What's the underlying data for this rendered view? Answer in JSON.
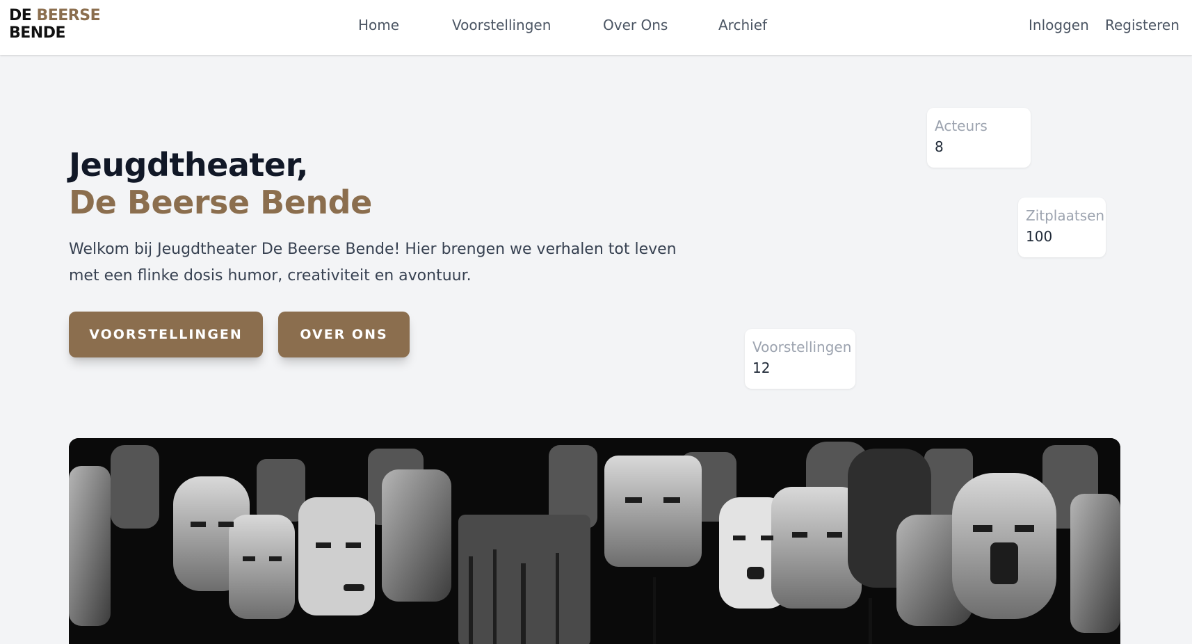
{
  "brand": {
    "line1_dark": "DE",
    "line1_accent": "BEERSE",
    "line2": "BENDE"
  },
  "nav": {
    "items": [
      {
        "label": "Home"
      },
      {
        "label": "Voorstellingen"
      },
      {
        "label": "Over Ons"
      },
      {
        "label": "Archief"
      }
    ],
    "login": "Inloggen",
    "register": "Registeren"
  },
  "hero": {
    "title_line1": "Jeugdtheater,",
    "title_line2": "De Beerse Bende",
    "intro": "Welkom bij Jeugdtheater De Beerse Bende! Hier brengen we verhalen tot leven met een flinke dosis humor, creativiteit en avontuur.",
    "primary_button": "VOORSTELLINGEN",
    "secondary_button": "OVER ONS",
    "image_icon": "theatre-masks-photo"
  },
  "stats": [
    {
      "label": "Acteurs",
      "value": "8"
    },
    {
      "label": "Zitplaatsen",
      "value": "100"
    },
    {
      "label": "Voorstellingen",
      "value": "12"
    }
  ],
  "colors": {
    "accent": "#8b6e4e",
    "background": "#f3f4f6",
    "text": "#111827",
    "muted": "#9ca3af"
  }
}
